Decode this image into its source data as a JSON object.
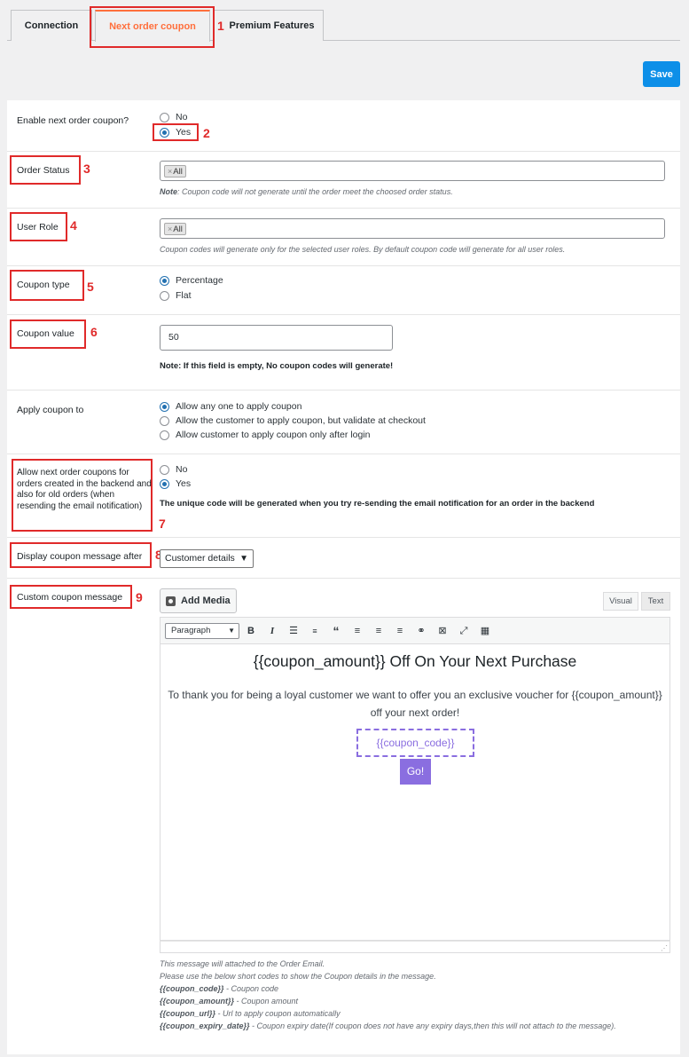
{
  "tabs": [
    {
      "label": "Connection"
    },
    {
      "label": "Next order coupon"
    },
    {
      "label": "Premium Features"
    }
  ],
  "save_label": "Save",
  "enable_coupon": {
    "label": "Enable next order coupon?",
    "options": [
      "No",
      "Yes"
    ],
    "selected": "Yes"
  },
  "order_status": {
    "label": "Order Status",
    "chip": "All",
    "note_prefix": "Note",
    "note": ": Coupon code will not generate until the order meet the choosed order status."
  },
  "user_role": {
    "label": "User Role",
    "chip": "All",
    "note": "Coupon codes will generate only for the selected user roles. By default coupon code will generate for all user roles."
  },
  "coupon_type": {
    "label": "Coupon type",
    "options": [
      "Percentage",
      "Flat"
    ],
    "selected": "Percentage"
  },
  "coupon_value": {
    "label": "Coupon value",
    "value": "50",
    "note": "Note: If this field is empty, No coupon codes will generate!"
  },
  "apply_coupon": {
    "label": "Apply coupon to",
    "options": [
      "Allow any one to apply coupon",
      "Allow the customer to apply coupon, but validate at checkout",
      "Allow customer to apply coupon only after login"
    ],
    "selected": "Allow any one to apply coupon"
  },
  "backend_orders": {
    "label": "Allow next order coupons for orders created in the backend and also for old orders (when resending the email notification)",
    "options": [
      "No",
      "Yes"
    ],
    "selected": "Yes",
    "note": "The unique code will be generated when you try re-sending the email notification for an order in the backend"
  },
  "display_after": {
    "label": "Display coupon message after",
    "selected": "Customer details"
  },
  "custom_message": {
    "label": "Custom coupon message",
    "add_media": "Add Media",
    "tab_visual": "Visual",
    "tab_text": "Text",
    "format": "Paragraph",
    "headline": "{{coupon_amount}} Off On Your Next Purchase",
    "paragraph": "To thank you for being a loyal customer we want to offer you an exclusive voucher for {{coupon_amount}} off your next order!",
    "code": "{{coupon_code}}",
    "button": "Go!"
  },
  "help": {
    "line1": "This message will attached to the Order Email.",
    "line2": "Please use the below short codes to show the Coupon details in the message.",
    "codes": [
      {
        "code": "{{coupon_code}}",
        "desc": " - Coupon code"
      },
      {
        "code": "{{coupon_amount}}",
        "desc": " - Coupon amount"
      },
      {
        "code": "{{coupon_url}}",
        "desc": " - Url to apply coupon automatically"
      },
      {
        "code": "{{coupon_expiry_date}}",
        "desc": " - Coupon expiry date(If coupon does not have any expiry days,then this will not attach to the message)."
      }
    ]
  },
  "annotations": [
    "1",
    "2",
    "3",
    "4",
    "5",
    "6",
    "7",
    "8",
    "9"
  ],
  "colors": {
    "accent": "#ff6f3c",
    "save": "#0d8fe8",
    "annotation": "#e02a2a",
    "coupon": "#8a6ee0"
  }
}
